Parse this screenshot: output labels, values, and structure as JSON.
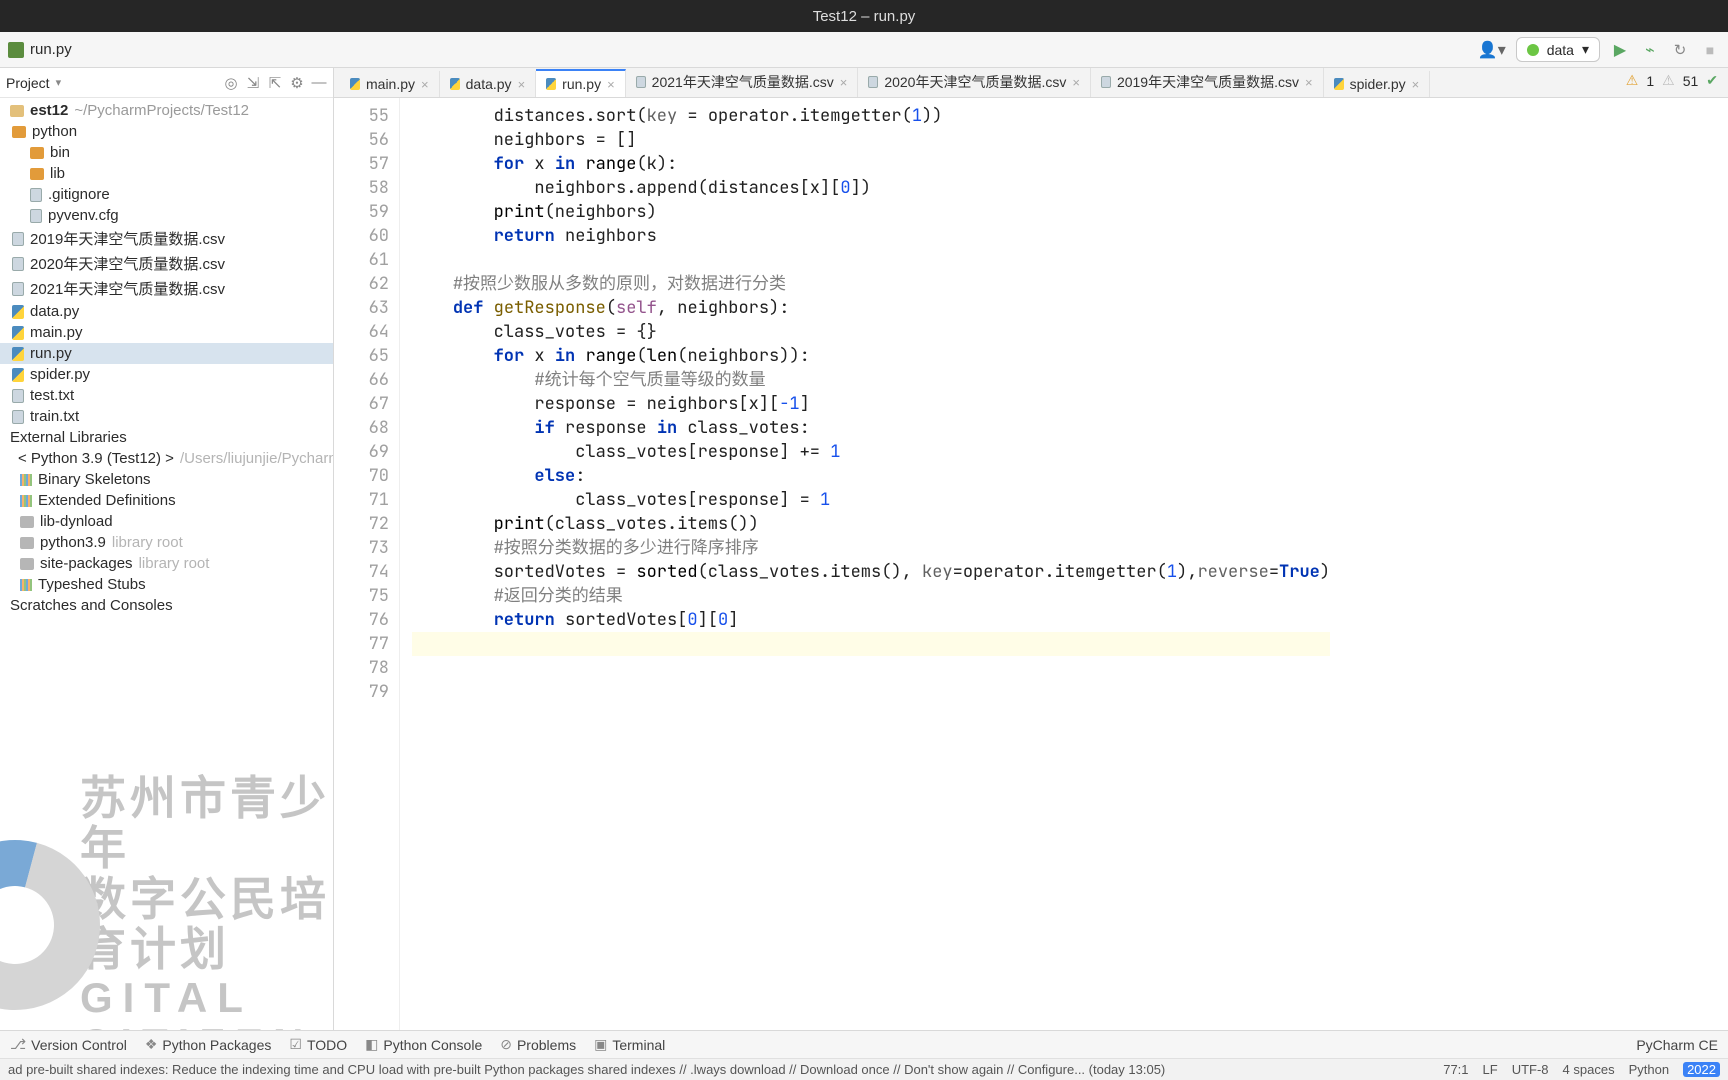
{
  "window": {
    "title": "Test12 – run.py"
  },
  "toolbar": {
    "breadcrumb_file": "run.py",
    "run_config": "data"
  },
  "project_header": {
    "label": "Project"
  },
  "tree": {
    "root": {
      "name": "est12",
      "path": "~/PycharmProjects/Test12"
    },
    "python_dir": "python",
    "bin": "bin",
    "lib": "lib",
    "gitignore": ".gitignore",
    "pyvenv": "pyvenv.cfg",
    "csv2019": "2019年天津空气质量数据.csv",
    "csv2020": "2020年天津空气质量数据.csv",
    "csv2021": "2021年天津空气质量数据.csv",
    "datapy": "data.py",
    "mainpy": "main.py",
    "runpy": "run.py",
    "spiderpy": "spider.py",
    "testtxt": "test.txt",
    "traintxt": "train.txt",
    "extlib": "External Libraries",
    "py39": "< Python 3.9 (Test12) >",
    "py39path": "/Users/liujunjie/Pycharm",
    "binskel": "Binary Skeletons",
    "extdef": "Extended Definitions",
    "libdyn": "lib-dynload",
    "py39d": "python3.9",
    "libroot": "library root",
    "sitepkg": "site-packages",
    "typeshed": "Typeshed Stubs",
    "scratches": "Scratches and Consoles"
  },
  "tabs": [
    {
      "label": "main.py",
      "close": "×"
    },
    {
      "label": "data.py",
      "close": "×"
    },
    {
      "label": "run.py",
      "close": "×",
      "active": true,
      "dirty": true
    },
    {
      "label": "2021年天津空气质量数据.csv",
      "close": "×"
    },
    {
      "label": "2020年天津空气质量数据.csv",
      "close": "×"
    },
    {
      "label": "2019年天津空气质量数据.csv",
      "close": "×"
    },
    {
      "label": "spider.py",
      "close": "×"
    }
  ],
  "inspections": {
    "warn": "1",
    "hints": "51"
  },
  "code_lines": [
    {
      "n": 55,
      "html": "        distances.sort(<span class='param'>key</span> = operator.itemgetter(<span class='num'>1</span>))"
    },
    {
      "n": 56,
      "html": "        neighbors = []"
    },
    {
      "n": 57,
      "html": "        <span class='kw'>for</span> x <span class='kw'>in</span> <span class='builtin'>range</span>(k):"
    },
    {
      "n": 58,
      "html": "            neighbors.append(distances[x][<span class='num'>0</span>])"
    },
    {
      "n": 59,
      "html": "        <span class='builtin'>print</span>(neighbors)"
    },
    {
      "n": 60,
      "html": "        <span class='kw'>return</span> neighbors"
    },
    {
      "n": 61,
      "html": ""
    },
    {
      "n": 62,
      "html": "    <span class='cmt'>#按照少数服从多数的原则，对数据进行分类</span>"
    },
    {
      "n": 63,
      "html": "    <span class='kw'>def</span> <span class='fn'>getResponse</span>(<span class='self'>self</span>, neighbors):"
    },
    {
      "n": 64,
      "html": "        class_votes = {}"
    },
    {
      "n": 65,
      "html": "        <span class='kw'>for</span> x <span class='kw'>in</span> <span class='builtin'>range</span>(<span class='builtin'>len</span>(neighbors)):"
    },
    {
      "n": 66,
      "html": "            <span class='cmt'>#统计每个空气质量等级的数量</span>"
    },
    {
      "n": 67,
      "html": "            response = neighbors[x][<span class='num'>-1</span>]"
    },
    {
      "n": 68,
      "html": "            <span class='kw'>if</span> response <span class='kw'>in</span> class_votes:"
    },
    {
      "n": 69,
      "html": "                class_votes[response] += <span class='num'>1</span>"
    },
    {
      "n": 70,
      "html": "            <span class='kw'>else</span>:"
    },
    {
      "n": 71,
      "html": "                class_votes[response] = <span class='num'>1</span>"
    },
    {
      "n": 72,
      "html": "        <span class='builtin'>print</span>(class_votes.items())"
    },
    {
      "n": 73,
      "html": "        <span class='cmt'>#按照分类数据的多少进行降序排序</span>"
    },
    {
      "n": 74,
      "html": "        sortedVotes = <span class='builtin'>sorted</span>(class_votes.items(), <span class='param'>key</span>=operator.itemgetter(<span class='num'>1</span>),<span class='param'>reverse</span>=<span class='kw'>True</span>)"
    },
    {
      "n": 75,
      "html": "        <span class='cmt'>#返回分类的结果</span>"
    },
    {
      "n": 76,
      "html": "        <span class='kw'>return</span> sortedVotes[<span class='num'>0</span>][<span class='num'>0</span>]"
    },
    {
      "n": 77,
      "html": "",
      "hl": true
    },
    {
      "n": 78,
      "html": ""
    },
    {
      "n": 79,
      "html": ""
    }
  ],
  "bottom_tools": {
    "vcs": "Version Control",
    "pkg": "Python Packages",
    "todo": "TODO",
    "pyconsole": "Python Console",
    "problems": "Problems",
    "terminal": "Terminal",
    "app": "PyCharm CE"
  },
  "statusbar": {
    "msg": "ad pre-built shared indexes: Reduce the indexing time and CPU load with pre-built Python packages shared indexes //  .lways download // Download once // Don't show again // Configure... (today 13:05)",
    "pos": "77:1",
    "lf": "LF",
    "enc": "UTF-8",
    "indent": "4 spaces",
    "interp": "Python",
    "year": "2022"
  },
  "watermark": {
    "l1": "苏州市青少年",
    "l2": "数字公民培育计划",
    "l3": "GITAL CITIZEN"
  }
}
